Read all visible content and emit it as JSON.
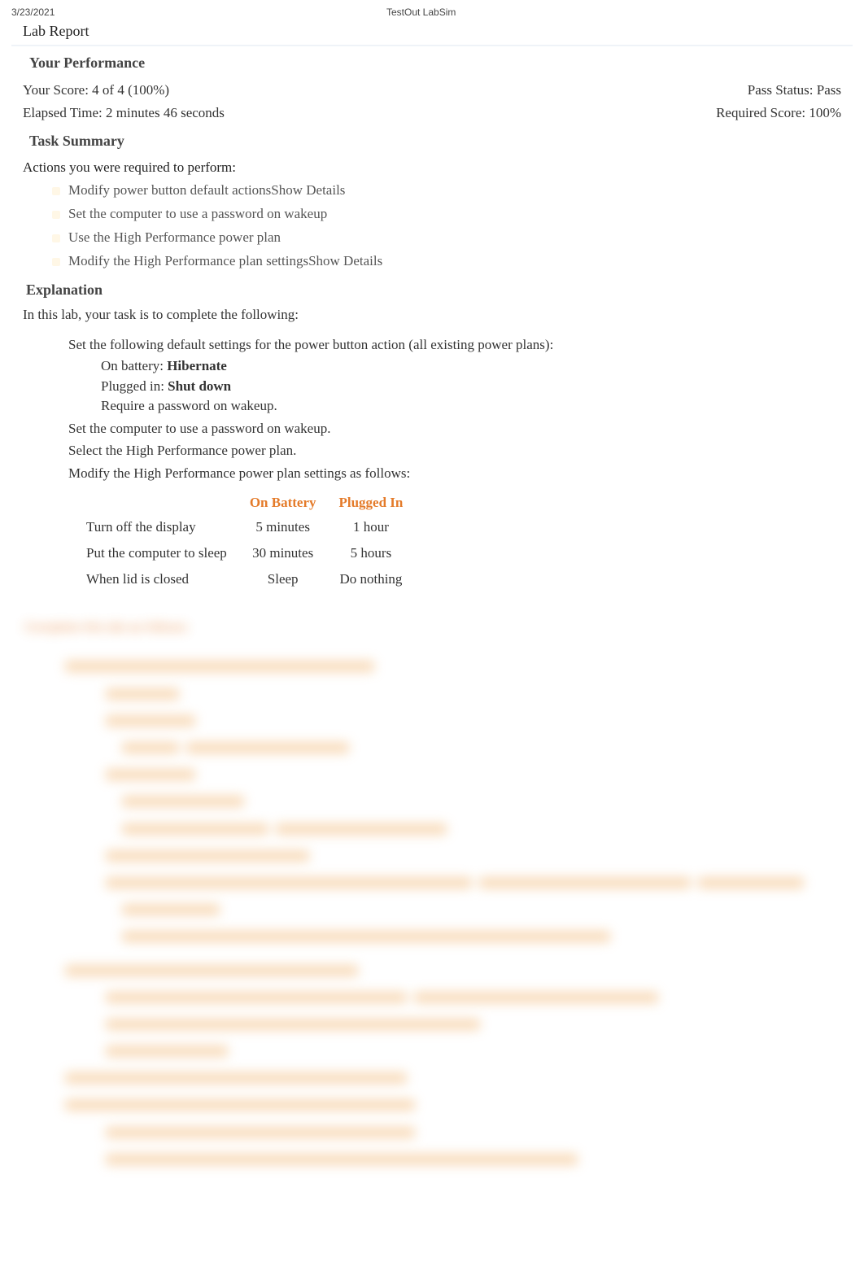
{
  "meta": {
    "date": "3/23/2021",
    "app": "TestOut LabSim"
  },
  "report": {
    "title": "Lab Report"
  },
  "performance": {
    "heading": "Your Performance",
    "score_label": "Your Score: 4 of 4 (100%)",
    "time_label": "Elapsed Time: 2 minutes 46 seconds",
    "pass_label": "Pass Status: Pass",
    "required_label": "Required Score: 100%"
  },
  "task_summary": {
    "heading": "Task Summary",
    "actions_title": "Actions you were required to perform:",
    "items": [
      "Modify power button default actionsShow Details",
      "Set the computer to use a password on wakeup",
      "Use the High Performance power plan",
      "Modify the High Performance plan settingsShow Details"
    ]
  },
  "explanation": {
    "heading": "Explanation",
    "intro": "In this lab, your task is to complete the following:",
    "main_item": "Set the following default settings for the power button action (all existing power plans):",
    "sub_items": {
      "battery_prefix": "On battery: ",
      "battery_value": "Hibernate",
      "plugged_prefix": "Plugged in: ",
      "plugged_value": "Shut down",
      "require_pw": "Require a password on wakeup."
    },
    "extra_items": [
      "Set the computer to use a password on wakeup.",
      "Select the High Performance power plan.",
      "Modify the High Performance power plan settings as follows:"
    ],
    "table": {
      "col1": "On Battery",
      "col2": "Plugged In",
      "rows": [
        {
          "label": "Turn off the display",
          "c1": "5 minutes",
          "c2": "1 hour"
        },
        {
          "label": "Put the computer to sleep",
          "c1": "30 minutes",
          "c2": "5 hours"
        },
        {
          "label": "When lid is closed",
          "c1": "Sleep",
          "c2": "Do nothing"
        }
      ]
    }
  },
  "redacted": {
    "heading": "Complete this lab as follows:"
  }
}
